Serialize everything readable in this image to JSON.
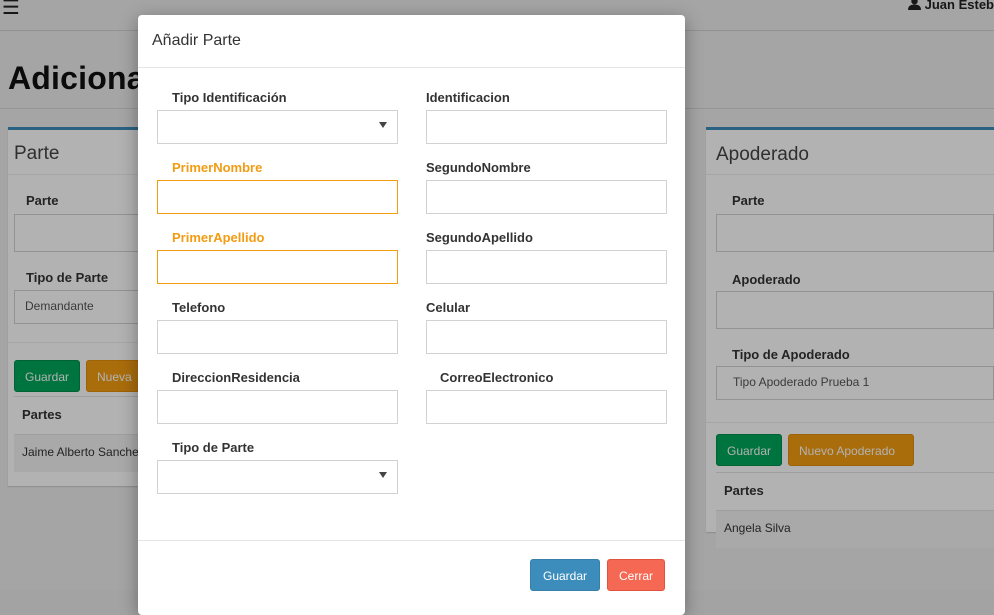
{
  "topbar": {
    "user_name": "Juan Esteb"
  },
  "page": {
    "title": "Adicionar"
  },
  "left_box": {
    "title": "Parte",
    "parte_label": "Parte",
    "tipo_parte_label": "Tipo de Parte",
    "tipo_parte_value": "Demandante",
    "save_label": "Guardar",
    "new_label": "Nueva",
    "table_header": "Partes",
    "rows": [
      "Jaime Alberto Sanche"
    ]
  },
  "right_box": {
    "title": "Apoderado",
    "parte_label": "Parte",
    "apoderado_label": "Apoderado",
    "tipo_apoderado_label": "Tipo de Apoderado",
    "tipo_apoderado_value": "Tipo Apoderado Prueba 1",
    "save_label": "Guardar",
    "new_label": "Nuevo Apoderado",
    "table_header": "Partes",
    "rows": [
      "Angela Silva"
    ]
  },
  "modal": {
    "title": "Añadir Parte",
    "fields": {
      "tipo_identificacion": {
        "label": "Tipo Identificación",
        "value": ""
      },
      "identificacion": {
        "label": "Identificacion",
        "value": ""
      },
      "primer_nombre": {
        "label": "PrimerNombre",
        "value": ""
      },
      "segundo_nombre": {
        "label": "SegundoNombre",
        "value": ""
      },
      "primer_apellido": {
        "label": "PrimerApellido",
        "value": ""
      },
      "segundo_apellido": {
        "label": "SegundoApellido",
        "value": ""
      },
      "telefono": {
        "label": "Telefono",
        "value": ""
      },
      "celular": {
        "label": "Celular",
        "value": ""
      },
      "direccion_residencia": {
        "label": "DireccionResidencia",
        "value": ""
      },
      "correo_electronico": {
        "label": "CorreoElectronico",
        "value": ""
      },
      "tipo_parte": {
        "label": "Tipo de Parte",
        "value": ""
      }
    },
    "save_label": "Guardar",
    "close_label": "Cerrar"
  },
  "colors": {
    "primary": "#3c8dbc",
    "success": "#00a65a",
    "warning": "#f39c12",
    "danger": "#f56954"
  },
  "icons": {
    "menu": "hamburger-icon",
    "user": "user-icon",
    "dropdown": "caret-down-icon"
  }
}
